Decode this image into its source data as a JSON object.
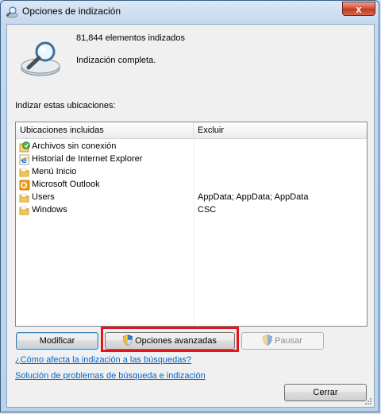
{
  "window": {
    "title": "Opciones de indización",
    "close_label": "x"
  },
  "status": {
    "count_text": "81,844 elementos indizados",
    "status_text": "Indización completa."
  },
  "locations": {
    "section_label": "Indizar estas ubicaciones:",
    "columns": {
      "included": "Ubicaciones incluidas",
      "exclude": "Excluir"
    },
    "rows": [
      {
        "name": "Archivos sin conexión",
        "exclude": "",
        "icon": "offline-files-icon"
      },
      {
        "name": "Historial de Internet Explorer",
        "exclude": "",
        "icon": "internet-explorer-icon"
      },
      {
        "name": "Menú Inicio",
        "exclude": "",
        "icon": "folder-icon"
      },
      {
        "name": "Microsoft Outlook",
        "exclude": "",
        "icon": "outlook-icon"
      },
      {
        "name": "Users",
        "exclude": "AppData; AppData; AppData",
        "icon": "folder-icon"
      },
      {
        "name": "Windows",
        "exclude": "CSC",
        "icon": "folder-icon"
      }
    ]
  },
  "buttons": {
    "modify": "Modificar",
    "advanced": "Opciones avanzadas",
    "pause": "Pausar",
    "close": "Cerrar"
  },
  "links": {
    "how_affects": "¿Cómo afecta la indización a las búsquedas?",
    "troubleshoot": "Solución de problemas de búsqueda e indización"
  },
  "colors": {
    "highlight": "#e3141b",
    "link": "#0066cc"
  }
}
